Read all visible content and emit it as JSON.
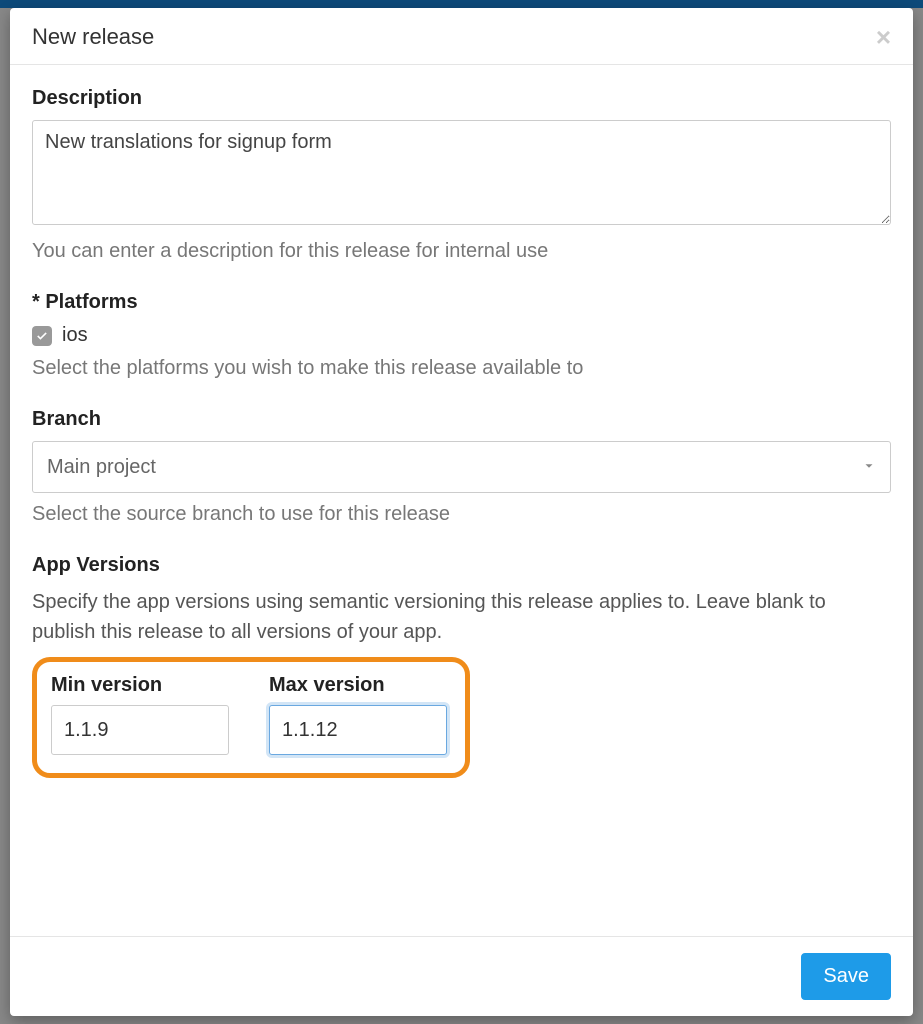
{
  "modal": {
    "title": "New release",
    "save_label": "Save"
  },
  "description": {
    "label": "Description",
    "value": "New translations for signup form",
    "hint": "You can enter a description for this release for internal use"
  },
  "platforms": {
    "label": "* Platforms",
    "options": [
      {
        "name": "ios",
        "checked": true
      }
    ],
    "hint": "Select the platforms you wish to make this release available to"
  },
  "branch": {
    "label": "Branch",
    "selected": "Main project",
    "hint": "Select the source branch to use for this release"
  },
  "app_versions": {
    "label": "App Versions",
    "description": "Specify the app versions using semantic versioning this release applies to. Leave blank to publish this release to all versions of your app.",
    "min_label": "Min version",
    "min_value": "1.1.9",
    "max_label": "Max version",
    "max_value": "1.1.12"
  }
}
